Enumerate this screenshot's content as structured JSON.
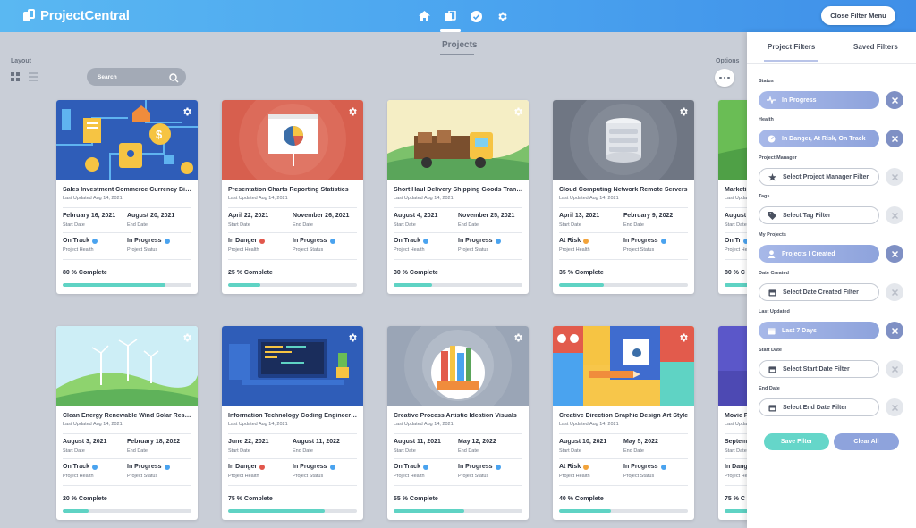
{
  "app": {
    "name": "ProjectCentral"
  },
  "header": {
    "close_filter_label": "Close Filter Menu",
    "nav": [
      "home-icon",
      "projects-icon",
      "tasks-icon",
      "settings-icon"
    ]
  },
  "page": {
    "title": "Projects",
    "layout_label": "Layout",
    "search_placeholder": "Search",
    "options_label": "Options"
  },
  "labels": {
    "start_date": "Start Date",
    "end_date": "End Date",
    "project_health": "Project Health",
    "project_status": "Project Status"
  },
  "colors": {
    "accent": "#4aa3ef",
    "progress": "#5fd3c4",
    "on_track": "#4aa3ef",
    "in_danger": "#e2574c",
    "at_risk": "#f2a33a",
    "in_progress": "#4aa3ef"
  },
  "projects": [
    {
      "title": "Sales Investment Commerce Currency Bitc...",
      "updated": "Last Updated Aug 14, 2021",
      "start": "February 16, 2021",
      "end": "August 20, 2021",
      "health": "On Track",
      "status": "In Progress",
      "complete_label": "80 % Complete",
      "progress": 0.8
    },
    {
      "title": "Presentation Charts Reporting Statistics",
      "updated": "Last Updated Aug 14, 2021",
      "start": "April 22, 2021",
      "end": "November 26, 2021",
      "health": "In Danger",
      "status": "In Progress",
      "complete_label": "25 % Complete",
      "progress": 0.25
    },
    {
      "title": "Short Haul Delivery Shipping Goods Transp...",
      "updated": "Last Updated Aug 14, 2021",
      "start": "August 4, 2021",
      "end": "November 25, 2021",
      "health": "On Track",
      "status": "In Progress",
      "complete_label": "30 % Complete",
      "progress": 0.3
    },
    {
      "title": "Cloud Computing Network Remote Servers",
      "updated": "Last Updated Aug 14, 2021",
      "start": "April 13, 2021",
      "end": "February 9, 2022",
      "health": "At Risk",
      "status": "In Progress",
      "complete_label": "35 % Complete",
      "progress": 0.35
    },
    {
      "title": "Marketi",
      "updated": "Last Updat",
      "start": "August",
      "end": "",
      "health": "On Tr",
      "status": "",
      "complete_label": "80 % C",
      "progress": 0.8
    },
    {
      "title": "Clean Energy Renewable Wind Solar Resour...",
      "updated": "Last Updated Aug 14, 2021",
      "start": "August 3, 2021",
      "end": "February 18, 2022",
      "health": "On Track",
      "status": "In Progress",
      "complete_label": "20 % Complete",
      "progress": 0.2
    },
    {
      "title": "Information Technology Coding Engineering",
      "updated": "Last Updated Aug 14, 2021",
      "start": "June 22, 2021",
      "end": "August 11, 2022",
      "health": "In Danger",
      "status": "In Progress",
      "complete_label": "75 % Complete",
      "progress": 0.75
    },
    {
      "title": "Creative Process Artistic Ideation Visuals",
      "updated": "Last Updated Aug 14, 2021",
      "start": "August 11, 2021",
      "end": "May 12, 2022",
      "health": "On Track",
      "status": "In Progress",
      "complete_label": "55 % Complete",
      "progress": 0.55
    },
    {
      "title": "Creative Direction Graphic Design Art Style",
      "updated": "Last Updated Aug 14, 2021",
      "start": "August 10, 2021",
      "end": "May 5, 2022",
      "health": "At Risk",
      "status": "In Progress",
      "complete_label": "40 % Complete",
      "progress": 0.4
    },
    {
      "title": "Movie P",
      "updated": "Last Updat",
      "start": "Septem",
      "end": "",
      "health": "In Dang",
      "status": "",
      "complete_label": "75 % C",
      "progress": 0.75
    }
  ],
  "filters": {
    "tabs": [
      "Project Filters",
      "Saved Filters"
    ],
    "groups": [
      {
        "label": "Status",
        "value": "In Progress",
        "active": true,
        "icon": "pulse-icon"
      },
      {
        "label": "Health",
        "value": "In Danger, At Risk, On Track",
        "active": true,
        "icon": "gauge-icon"
      },
      {
        "label": "Project Manager",
        "value": "Select Project Manager Filter",
        "active": false,
        "icon": "star-icon"
      },
      {
        "label": "Tags",
        "value": "Select Tag Filter",
        "active": false,
        "icon": "tag-icon"
      },
      {
        "label": "My Projects",
        "value": "Projects I Created",
        "active": true,
        "icon": "person-icon"
      },
      {
        "label": "Date Created",
        "value": "Select Date Created Filter",
        "active": false,
        "icon": "calendar-icon"
      },
      {
        "label": "Last Updated",
        "value": "Last 7 Days",
        "active": true,
        "icon": "calendar-icon"
      },
      {
        "label": "Start Date",
        "value": "Select Start Date Filter",
        "active": false,
        "icon": "calendar-icon"
      },
      {
        "label": "End Date",
        "value": "Select End Date Filter",
        "active": false,
        "icon": "calendar-icon"
      }
    ],
    "save_label": "Save Filter",
    "clear_label": "Clear All"
  }
}
